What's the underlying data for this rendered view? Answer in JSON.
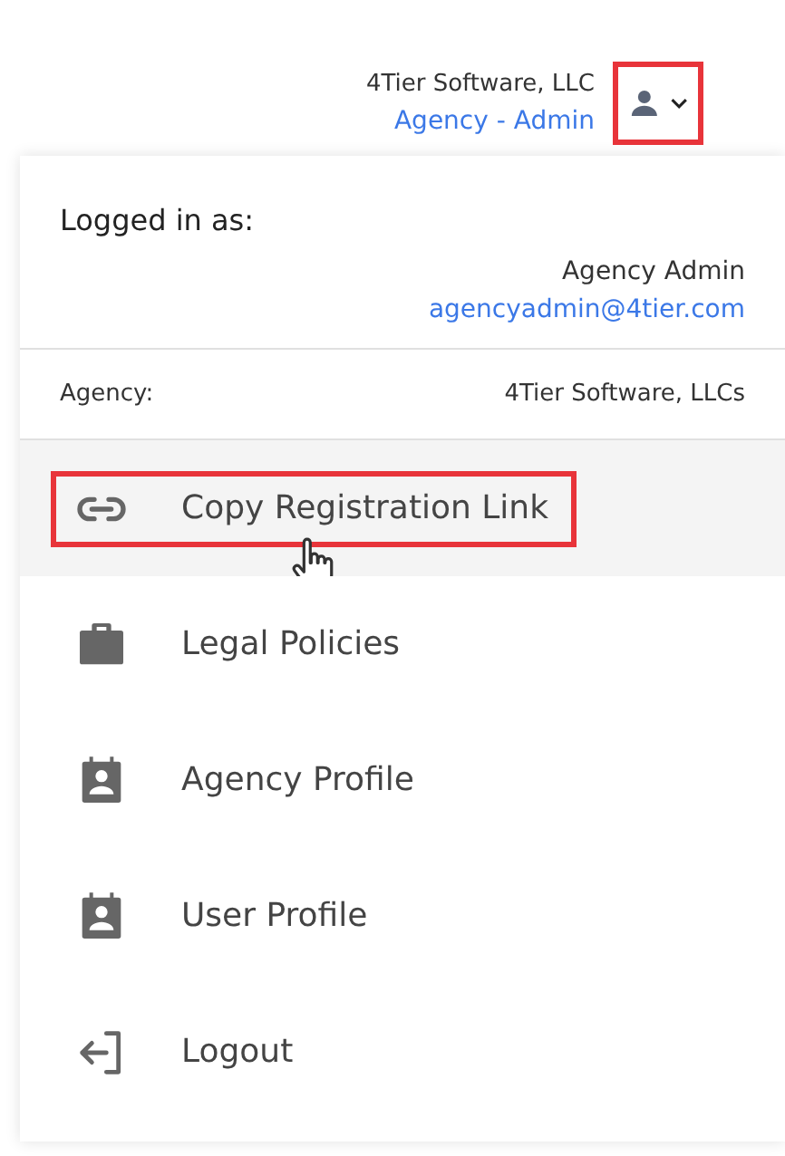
{
  "header": {
    "organization": "4Tier Software, LLC",
    "role": "Agency - Admin",
    "user_button": {
      "annotated": true
    }
  },
  "account": {
    "heading": "Logged in as:",
    "name": "Agency Admin",
    "email": "agencyadmin@4tier.com"
  },
  "agency": {
    "label": "Agency:",
    "value": "4Tier Software, LLCs"
  },
  "menu": [
    {
      "kind": "link",
      "label": "Copy Registration Link",
      "selected": true,
      "annotated": true
    },
    {
      "kind": "briefcase",
      "label": "Legal Policies",
      "selected": false,
      "annotated": false
    },
    {
      "kind": "badge",
      "label": "Agency Profile",
      "selected": false,
      "annotated": false
    },
    {
      "kind": "badge",
      "label": "User Profile",
      "selected": false,
      "annotated": false
    },
    {
      "kind": "logout",
      "label": "Logout",
      "selected": false,
      "annotated": false
    }
  ]
}
